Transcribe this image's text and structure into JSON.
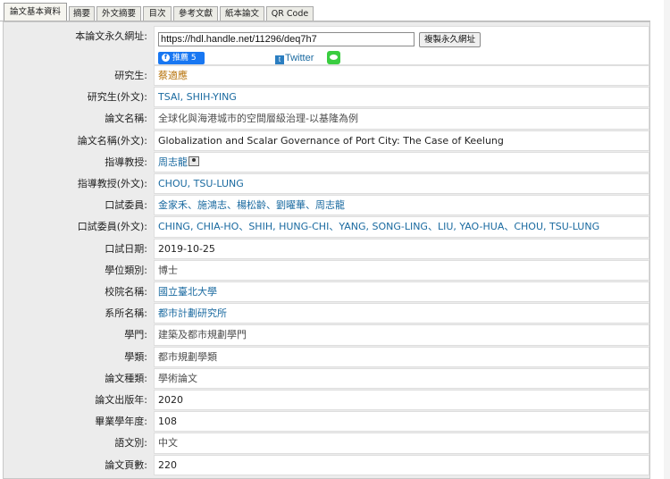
{
  "tabs": [
    {
      "label": "論文基本資料",
      "active": true
    },
    {
      "label": "摘要",
      "active": false
    },
    {
      "label": "外文摘要",
      "active": false
    },
    {
      "label": "目次",
      "active": false
    },
    {
      "label": "參考文獻",
      "active": false
    },
    {
      "label": "紙本論文",
      "active": false
    },
    {
      "label": "QR Code",
      "active": false
    }
  ],
  "permalink": {
    "label": "本論文永久網址:",
    "url": "https://hdl.handle.net/11296/deq7h7",
    "copy_button": "複製永久網址",
    "fb_label": "推薦 5",
    "twitter_label": "Twitter"
  },
  "fields": [
    {
      "label": "研究生:",
      "value": "蔡適應",
      "style": "orange"
    },
    {
      "label": "研究生(外文):",
      "value": "TSAI, SHIH-YING",
      "style": "link"
    },
    {
      "label": "論文名稱:",
      "value": "全球化與海港城市的空間層級治理-以基隆為例",
      "style": "dark"
    },
    {
      "label": "論文名稱(外文):",
      "value": "Globalization and Scalar Governance of Port City: The Case of Keelung",
      "style": "black"
    },
    {
      "label": "指導教授:",
      "value": "周志龍",
      "style": "link",
      "icon": "advisor-person-icon"
    },
    {
      "label": "指導教授(外文):",
      "value": "CHOU, TSU-LUNG",
      "style": "link"
    },
    {
      "label": "口試委員:",
      "value": "金家禾、施鴻志、楊松齡、劉曜華、周志龍",
      "style": "link"
    },
    {
      "label": "口試委員(外文):",
      "value": "CHING, CHIA-HO、SHIH, HUNG-CHI、YANG, SONG-LING、LIU, YAO-HUA、CHOU, TSU-LUNG",
      "style": "link"
    },
    {
      "label": "口試日期:",
      "value": "2019-10-25",
      "style": "black"
    },
    {
      "label": "學位類別:",
      "value": "博士",
      "style": "dark"
    },
    {
      "label": "校院名稱:",
      "value": "國立臺北大學",
      "style": "link"
    },
    {
      "label": "系所名稱:",
      "value": "都市計劃研究所",
      "style": "link"
    },
    {
      "label": "學門:",
      "value": "建築及都市規劃學門",
      "style": "dark"
    },
    {
      "label": "學類:",
      "value": "都市規劃學類",
      "style": "dark"
    },
    {
      "label": "論文種類:",
      "value": "學術論文",
      "style": "dark"
    },
    {
      "label": "論文出版年:",
      "value": "2020",
      "style": "black"
    },
    {
      "label": "畢業學年度:",
      "value": "108",
      "style": "black"
    },
    {
      "label": "語文別:",
      "value": "中文",
      "style": "dark"
    },
    {
      "label": "論文頁數:",
      "value": "220",
      "style": "black"
    }
  ],
  "colors": {
    "link": "#1a6aa0",
    "orange": "#b8750f",
    "dark": "#4d4d4d",
    "black": "#1f1f1f"
  }
}
